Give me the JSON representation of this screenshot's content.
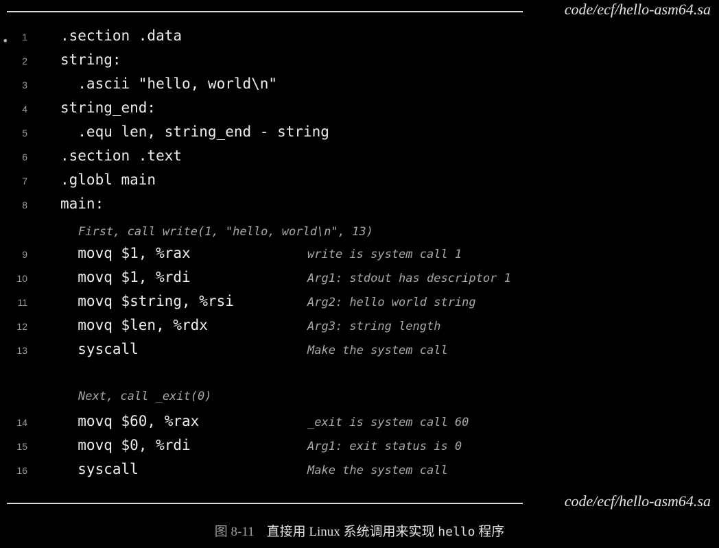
{
  "filename_top": "code/ecf/hello-asm64.sa",
  "filename_bottom": "code/ecf/hello-asm64.sa",
  "lines": [
    {
      "num": "1",
      "code": ".section .data",
      "comment": ""
    },
    {
      "num": "2",
      "code": "string:",
      "comment": ""
    },
    {
      "num": "3",
      "code": "  .ascii \"hello, world\\n\"",
      "comment": ""
    },
    {
      "num": "4",
      "code": "string_end:",
      "comment": ""
    },
    {
      "num": "5",
      "code": "  .equ len, string_end - string",
      "comment": ""
    },
    {
      "num": "6",
      "code": ".section .text",
      "comment": ""
    },
    {
      "num": "7",
      "code": ".globl main",
      "comment": ""
    },
    {
      "num": "8",
      "code": "main:",
      "comment": ""
    },
    {
      "num": "9",
      "code": "  movq $1, %rax",
      "comment": "write is system call 1"
    },
    {
      "num": "10",
      "code": "  movq $1, %rdi",
      "comment": "Arg1: stdout has descriptor 1"
    },
    {
      "num": "11",
      "code": "  movq $string, %rsi",
      "comment": "Arg2: hello world string"
    },
    {
      "num": "12",
      "code": "  movq $len, %rdx",
      "comment": "Arg3: string length"
    },
    {
      "num": "13",
      "code": "  syscall",
      "comment": "Make the system call"
    },
    {
      "num": "14",
      "code": "  movq $60, %rax",
      "comment": "_exit is system call 60"
    },
    {
      "num": "15",
      "code": "  movq $0, %rdi",
      "comment": "Arg1: exit status is 0"
    },
    {
      "num": "16",
      "code": "  syscall",
      "comment": "Make the system call"
    }
  ],
  "note_first": "First, call write(1, \"hello, world\\n\", 13)",
  "note_next": "Next, call _exit(0)",
  "caption": {
    "figure": "图 8-11",
    "text_before": "直接用 Linux 系统调用来实现 ",
    "code": "hello",
    "text_after": " 程序"
  }
}
